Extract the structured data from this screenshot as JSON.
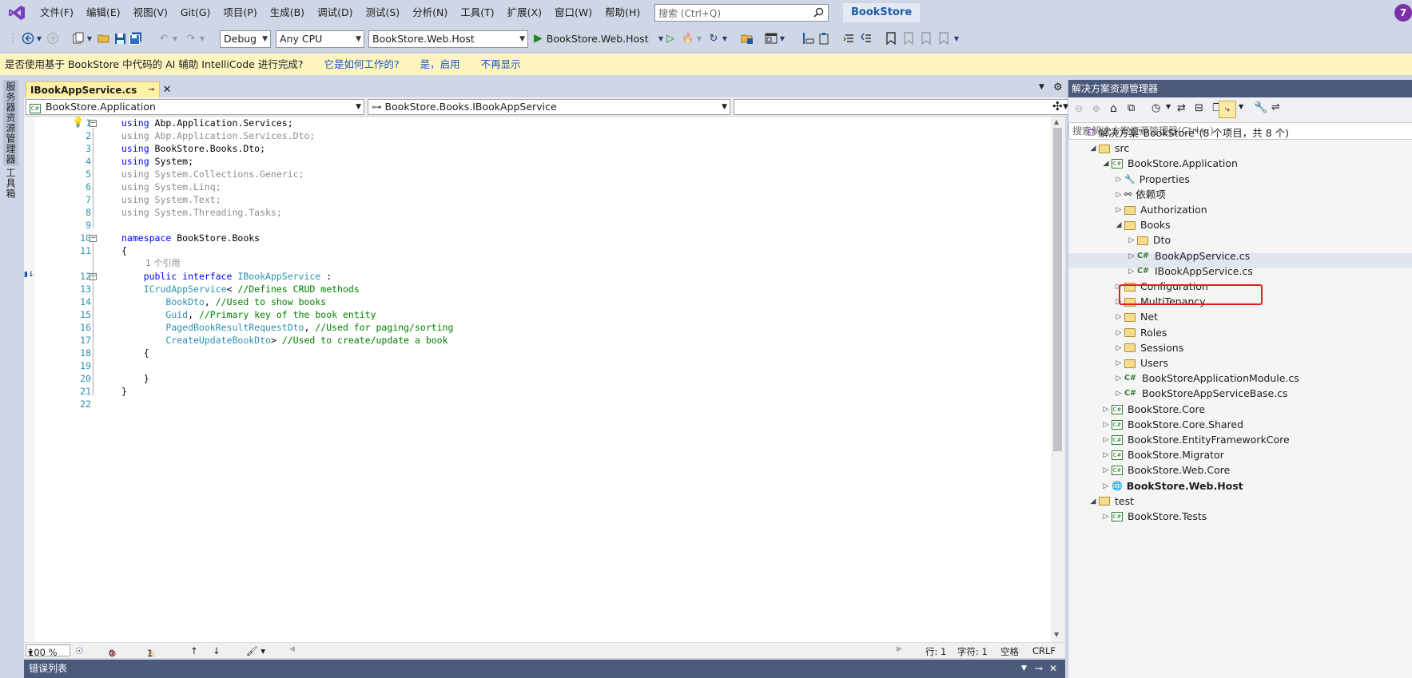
{
  "menubar": {
    "items": [
      "文件(F)",
      "编辑(E)",
      "视图(V)",
      "Git(G)",
      "项目(P)",
      "生成(B)",
      "调试(D)",
      "测试(S)",
      "分析(N)",
      "工具(T)",
      "扩展(X)",
      "窗口(W)",
      "帮助(H)"
    ],
    "search_placeholder": "搜索 (Ctrl+Q)",
    "app_title": "BookStore",
    "user_initial": "7"
  },
  "toolbar": {
    "config": "Debug",
    "platform": "Any CPU",
    "startup_project": "BookStore.Web.Host",
    "run_label": "BookStore.Web.Host"
  },
  "infobar": {
    "message": "是否使用基于 BookStore 中代码的 AI 辅助 IntelliCode 进行完成?",
    "link_how": "它是如何工作的?",
    "link_yes": "是，启用",
    "link_never": "不再显示"
  },
  "leftstrip": {
    "tab1": "服务器资源管理器",
    "tab2": "工具箱"
  },
  "editor": {
    "tab_label": "IBookAppService.cs",
    "nav_project": "BookStore.Application",
    "nav_type": "BookStore.Books.IBookAppService",
    "nav_member": "",
    "ref_count": "1 个引用",
    "lines": [
      {
        "n": "1",
        "parts": [
          [
            "kw",
            "using"
          ],
          [
            "tx",
            " Abp.Application.Services;"
          ]
        ]
      },
      {
        "n": "2",
        "parts": [
          [
            "dim",
            "using Abp.Application.Services.Dto;"
          ]
        ]
      },
      {
        "n": "3",
        "parts": [
          [
            "kw",
            "using"
          ],
          [
            "tx",
            " BookStore.Books.Dto;"
          ]
        ]
      },
      {
        "n": "4",
        "parts": [
          [
            "kw",
            "using"
          ],
          [
            "tx",
            " System;"
          ]
        ]
      },
      {
        "n": "5",
        "parts": [
          [
            "dim",
            "using System.Collections.Generic;"
          ]
        ]
      },
      {
        "n": "6",
        "parts": [
          [
            "dim",
            "using System.Linq;"
          ]
        ]
      },
      {
        "n": "7",
        "parts": [
          [
            "dim",
            "using System.Text;"
          ]
        ]
      },
      {
        "n": "8",
        "parts": [
          [
            "dim",
            "using System.Threading.Tasks;"
          ]
        ]
      },
      {
        "n": "9",
        "parts": []
      },
      {
        "n": "10",
        "parts": [
          [
            "kw",
            "namespace"
          ],
          [
            "tx",
            " BookStore.Books"
          ]
        ]
      },
      {
        "n": "11",
        "parts": [
          [
            "tx",
            "{"
          ]
        ]
      },
      {
        "n": "12",
        "parts": [
          [
            "tx",
            "    "
          ],
          [
            "kw",
            "public interface"
          ],
          [
            "tx",
            " "
          ],
          [
            "ty",
            "IBookAppService"
          ],
          [
            "tx",
            " :"
          ]
        ]
      },
      {
        "n": "13",
        "parts": [
          [
            "tx",
            "    "
          ],
          [
            "ty",
            "ICrudAppService"
          ],
          [
            "tx",
            "< "
          ],
          [
            "cm",
            "//Defines CRUD methods"
          ]
        ]
      },
      {
        "n": "14",
        "parts": [
          [
            "tx",
            "        "
          ],
          [
            "ty",
            "BookDto"
          ],
          [
            "tx",
            ", "
          ],
          [
            "cm",
            "//Used to show books"
          ]
        ]
      },
      {
        "n": "15",
        "parts": [
          [
            "tx",
            "        "
          ],
          [
            "ty",
            "Guid"
          ],
          [
            "tx",
            ", "
          ],
          [
            "cm",
            "//Primary key of the book entity"
          ]
        ]
      },
      {
        "n": "16",
        "parts": [
          [
            "tx",
            "        "
          ],
          [
            "ty",
            "PagedBookResultRequestDto"
          ],
          [
            "tx",
            ", "
          ],
          [
            "cm",
            "//Used for paging/sorting"
          ]
        ]
      },
      {
        "n": "17",
        "parts": [
          [
            "tx",
            "        "
          ],
          [
            "ty",
            "CreateUpdateBookDto"
          ],
          [
            "tx",
            "> "
          ],
          [
            "cm",
            "//Used to create/update a book"
          ]
        ]
      },
      {
        "n": "18",
        "parts": [
          [
            "tx",
            "    {"
          ]
        ]
      },
      {
        "n": "19",
        "parts": []
      },
      {
        "n": "20",
        "parts": [
          [
            "tx",
            "    }"
          ]
        ]
      },
      {
        "n": "21",
        "parts": [
          [
            "tx",
            "}"
          ]
        ]
      },
      {
        "n": "22",
        "parts": []
      }
    ]
  },
  "status": {
    "zoom": "100 %",
    "errors": "0",
    "warnings": "1",
    "line": "行: 1",
    "char": "字符: 1",
    "indent": "空格",
    "eol": "CRLF"
  },
  "bottom_panel": {
    "title": "错误列表"
  },
  "solution_explorer": {
    "title": "解决方案资源管理器",
    "search_placeholder": "搜索解决方案资源管理器(Ctrl+;)",
    "tree": [
      {
        "label": "解决方案\"BookStore\"(8 个项目，共 8 个)",
        "kind": "solution",
        "depth": 0,
        "tri": ""
      },
      {
        "label": "src",
        "kind": "folder",
        "depth": 1,
        "tri": "open"
      },
      {
        "label": "BookStore.Application",
        "kind": "project",
        "depth": 2,
        "tri": "open"
      },
      {
        "label": "Properties",
        "kind": "props",
        "depth": 3,
        "tri": "closed"
      },
      {
        "label": "依赖项",
        "kind": "deps",
        "depth": 3,
        "tri": "closed"
      },
      {
        "label": "Authorization",
        "kind": "folder",
        "depth": 3,
        "tri": "closed"
      },
      {
        "label": "Books",
        "kind": "folder",
        "depth": 3,
        "tri": "open"
      },
      {
        "label": "Dto",
        "kind": "folder",
        "depth": 4,
        "tri": "closed"
      },
      {
        "label": "BookAppService.cs",
        "kind": "cs",
        "depth": 4,
        "tri": "closed"
      },
      {
        "label": "IBookAppService.cs",
        "kind": "cs",
        "depth": 4,
        "tri": "closed"
      },
      {
        "label": "Configuration",
        "kind": "folder",
        "depth": 3,
        "tri": "closed"
      },
      {
        "label": "MultiTenancy",
        "kind": "folder",
        "depth": 3,
        "tri": "closed"
      },
      {
        "label": "Net",
        "kind": "folder",
        "depth": 3,
        "tri": "closed"
      },
      {
        "label": "Roles",
        "kind": "folder",
        "depth": 3,
        "tri": "closed"
      },
      {
        "label": "Sessions",
        "kind": "folder",
        "depth": 3,
        "tri": "closed"
      },
      {
        "label": "Users",
        "kind": "folder",
        "depth": 3,
        "tri": "closed"
      },
      {
        "label": "BookStoreApplicationModule.cs",
        "kind": "cs",
        "depth": 3,
        "tri": "closed"
      },
      {
        "label": "BookStoreAppServiceBase.cs",
        "kind": "cs",
        "depth": 3,
        "tri": "closed"
      },
      {
        "label": "BookStore.Core",
        "kind": "project",
        "depth": 2,
        "tri": "closed"
      },
      {
        "label": "BookStore.Core.Shared",
        "kind": "project",
        "depth": 2,
        "tri": "closed"
      },
      {
        "label": "BookStore.EntityFrameworkCore",
        "kind": "project",
        "depth": 2,
        "tri": "closed"
      },
      {
        "label": "BookStore.Migrator",
        "kind": "project",
        "depth": 2,
        "tri": "closed"
      },
      {
        "label": "BookStore.Web.Core",
        "kind": "project",
        "depth": 2,
        "tri": "closed"
      },
      {
        "label": "BookStore.Web.Host",
        "kind": "webproject",
        "depth": 2,
        "tri": "closed",
        "bold": true
      },
      {
        "label": "test",
        "kind": "folder",
        "depth": 1,
        "tri": "open"
      },
      {
        "label": "BookStore.Tests",
        "kind": "project",
        "depth": 2,
        "tri": "closed"
      }
    ]
  },
  "colors": {
    "keyword": "#0000ff",
    "type": "#2b91af",
    "comment": "#008000",
    "highlight": "#e02020"
  }
}
